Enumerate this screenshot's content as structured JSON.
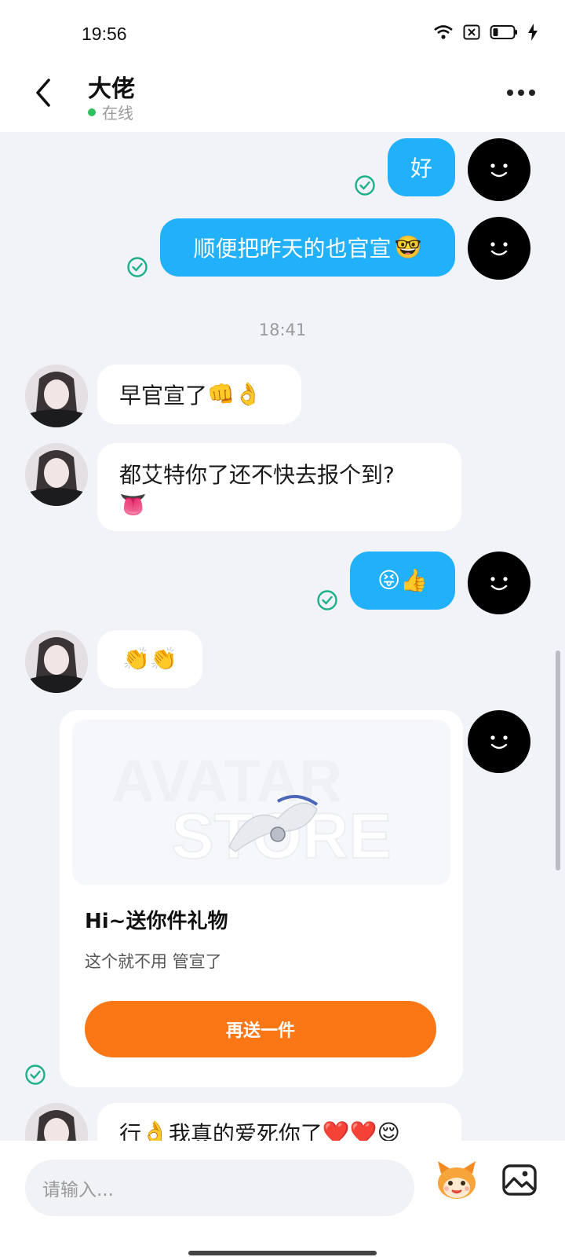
{
  "status_bar": {
    "time": "19:56"
  },
  "header": {
    "name": "大佬",
    "status": "在线"
  },
  "messages": {
    "m1": "好",
    "m2": "顺便把昨天的也官宣",
    "time_sep": "18:41",
    "m3": "早官宣了",
    "m4": "都艾特你了还不快去报个到?",
    "m6_partial": "行",
    "m6_text": "我真的爱死你了"
  },
  "gift": {
    "title": "Hi~送你件礼物",
    "subtitle": "这个就不用 管宣了",
    "button": "再送一件",
    "watermark_line1": "AVATAR",
    "watermark_line2": "STORE"
  },
  "input": {
    "placeholder": "请输入..."
  },
  "colors": {
    "outgoing_bubble": "#21b1fb",
    "incoming_bubble": "#ffffff",
    "accent_button": "#fb7615",
    "online_dot": "#2ec05e",
    "check": "#1fb08a"
  },
  "icons": [
    "back-icon",
    "more-icon",
    "wifi-icon",
    "close-box-icon",
    "battery-icon",
    "charging-icon",
    "check-icon",
    "smile-face-icon",
    "mascot-icon",
    "image-icon"
  ]
}
